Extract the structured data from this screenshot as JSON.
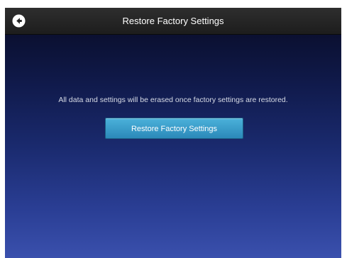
{
  "header": {
    "back_icon": "back-arrow-icon",
    "title": "Restore Factory Settings"
  },
  "main": {
    "message": "All data and settings will be erased once factory settings are restored.",
    "restore_button_label": "Restore Factory Settings"
  },
  "colors": {
    "header_bg": "#262626",
    "button_accent": "#3a9fcc",
    "background_top": "#0b1031",
    "background_bottom": "#3a50ad"
  }
}
